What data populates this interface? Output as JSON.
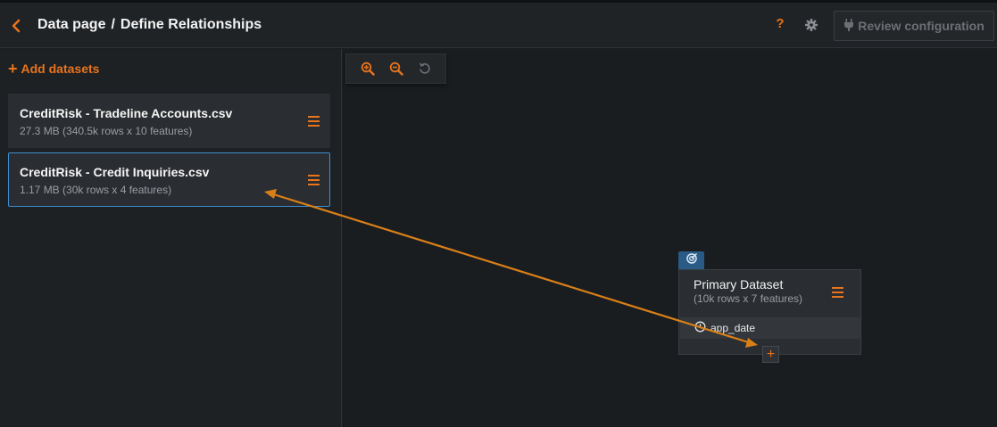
{
  "header": {
    "breadcrumb_parent": "Data page",
    "breadcrumb_separator": "/",
    "breadcrumb_current": "Define Relationships",
    "help_label": "?",
    "review_button_label": "Review configuration",
    "review_button_enabled": false
  },
  "sidebar": {
    "add_datasets_label": "Add datasets",
    "datasets": [
      {
        "name": "CreditRisk - Tradeline Accounts.csv",
        "meta": "27.3 MB (340.5k rows x 10 features)",
        "selected": false
      },
      {
        "name": "CreditRisk - Credit Inquiries.csv",
        "meta": "1.17 MB (30k rows x 4 features)",
        "selected": true
      }
    ]
  },
  "toolbar": {
    "icons": [
      "zoom-in-icon",
      "zoom-out-icon",
      "reset-icon"
    ]
  },
  "canvas": {
    "primary_node": {
      "title": "Primary Dataset",
      "subtitle": "(10k rows x 7 features)",
      "date_field": "app_date",
      "add_relationship_label": "+"
    }
  },
  "colors": {
    "accent": "#e8741c",
    "selection_border": "#3d8ed0",
    "badge": "#2a5a86",
    "background": "#1a1d20",
    "panel": "#1e2124",
    "card": "#2a2d31"
  }
}
